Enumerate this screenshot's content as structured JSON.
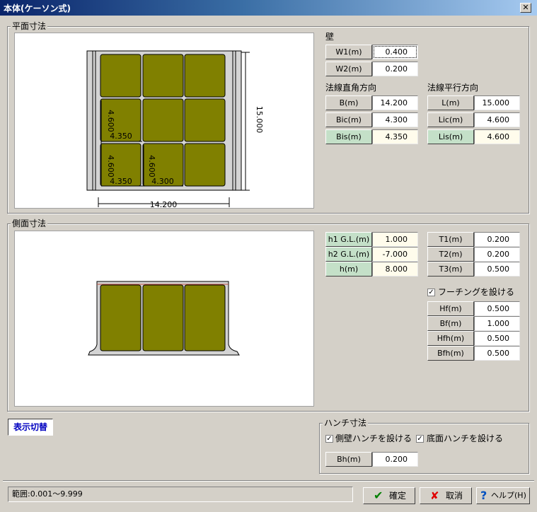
{
  "window": {
    "title": "本体(ケーソン式)",
    "close_label": "✕"
  },
  "plan": {
    "group_label": "平面寸法",
    "wall": {
      "label": "壁",
      "rows": [
        {
          "name": "W1(m)",
          "value": "0.400"
        },
        {
          "name": "W2(m)",
          "value": "0.200"
        }
      ]
    },
    "perp": {
      "label": "法線直角方向",
      "rows": [
        {
          "name": "B(m)",
          "value": "14.200"
        },
        {
          "name": "Bic(m)",
          "value": "4.300"
        },
        {
          "name": "Bis(m)",
          "value": "4.350"
        }
      ]
    },
    "para": {
      "label": "法線平行方向",
      "rows": [
        {
          "name": "L(m)",
          "value": "15.000"
        },
        {
          "name": "Lic(m)",
          "value": "4.600"
        },
        {
          "name": "Lis(m)",
          "value": "4.600"
        }
      ]
    },
    "drawing": {
      "dim_b": "14.200",
      "dim_l": "15.000",
      "dim_bs": "4.350",
      "dim_bc": "4.300",
      "dim_ls": "4.600",
      "dim_lc": "4.600"
    }
  },
  "side": {
    "group_label": "側面寸法",
    "rows_h": [
      {
        "name": "h1 G.L.(m)",
        "value": "1.000"
      },
      {
        "name": "h2 G.L.(m)",
        "value": "-7.000"
      },
      {
        "name": "h(m)",
        "value": "8.000"
      }
    ],
    "rows_t": [
      {
        "name": "T1(m)",
        "value": "0.200"
      },
      {
        "name": "T2(m)",
        "value": "0.200"
      },
      {
        "name": "T3(m)",
        "value": "0.500"
      }
    ],
    "footing_label": "フーチングを設ける",
    "rows_f": [
      {
        "name": "Hf(m)",
        "value": "0.500"
      },
      {
        "name": "Bf(m)",
        "value": "1.000"
      },
      {
        "name": "Hfh(m)",
        "value": "0.500"
      },
      {
        "name": "Bfh(m)",
        "value": "0.500"
      }
    ]
  },
  "display_toggle": "表示切替",
  "haunch": {
    "group_label": "ハンチ寸法",
    "side_label": "側壁ハンチを設ける",
    "bottom_label": "底面ハンチを設ける",
    "bh_name": "Bh(m)",
    "bh_value": "0.200"
  },
  "status": "範囲:0.001〜9.999",
  "buttons": {
    "ok": "確定",
    "cancel": "取消",
    "help": "ヘルプ(H)"
  },
  "colors": {
    "cell": "#808000",
    "titlebar": "#0a246a",
    "selected_btn": "#c4e0c8"
  }
}
